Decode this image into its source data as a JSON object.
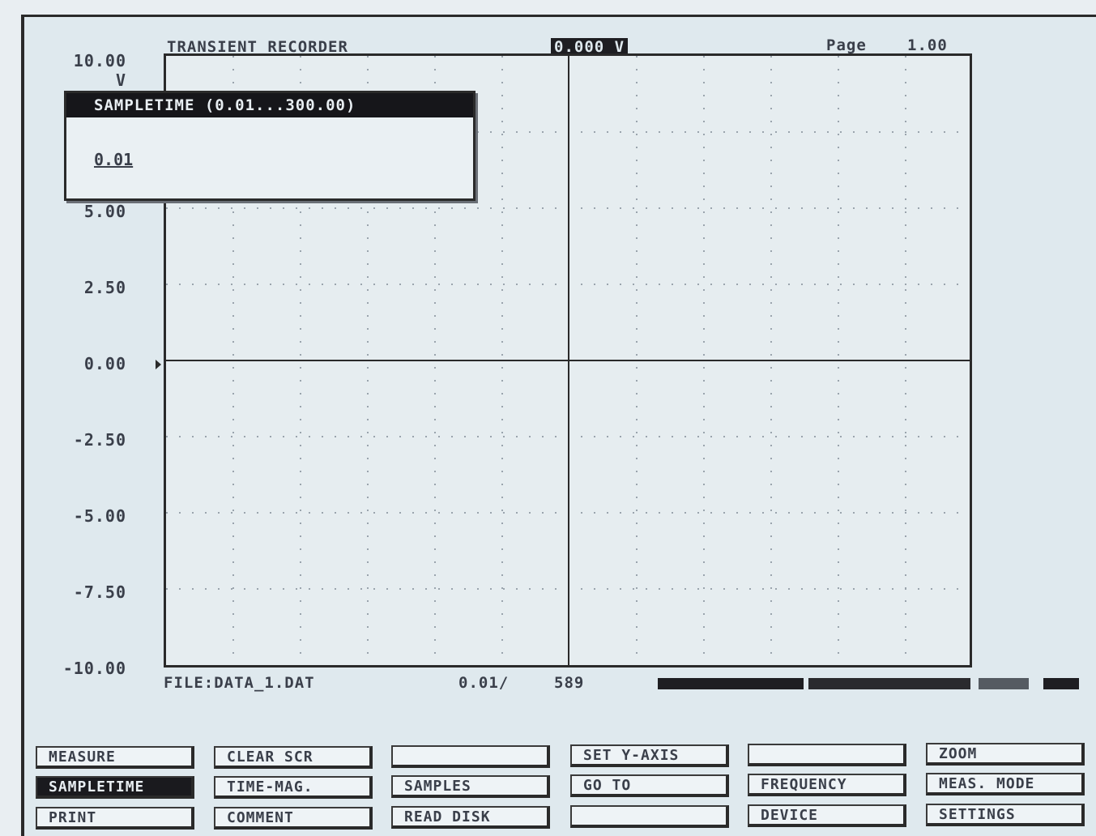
{
  "header": {
    "title": "TRANSIENT RECORDER",
    "cursor_value": "0.000 V",
    "page_label": "Page",
    "page_value": "1.00"
  },
  "y_axis": {
    "unit": "V",
    "ticks": [
      "10.00",
      "5.00",
      "2.50",
      "0.00",
      "-2.50",
      "-5.00",
      "-7.50",
      "-10.00"
    ]
  },
  "dialog": {
    "title": "SAMPLETIME  (0.01...300.00)",
    "value": "0.01"
  },
  "status": {
    "file": "FILE:DATA_1.DAT",
    "sampletime": "0.01/",
    "samples": "589"
  },
  "function_keys": [
    [
      "MEASURE",
      "CLEAR SCR",
      "",
      "SET Y-AXIS",
      "",
      "ZOOM"
    ],
    [
      "SAMPLETIME",
      "TIME-MAG.",
      "SAMPLES",
      "GO TO",
      "FREQUENCY",
      "MEAS. MODE"
    ],
    [
      "PRINT",
      "COMMENT",
      "READ DISK",
      "",
      "DEVICE",
      "SETTINGS"
    ]
  ],
  "active_key": "SAMPLETIME",
  "colors": {
    "screen_bg": "#dfe9ee",
    "ink": "#2a2a2a",
    "inverse_bg": "#16161a"
  }
}
